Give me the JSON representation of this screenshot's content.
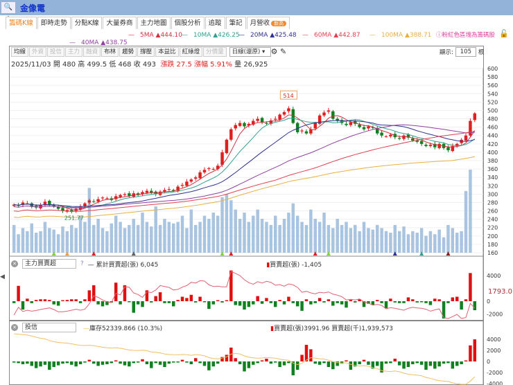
{
  "window": {
    "title": "金像電",
    "zoom_icon": "zoom-in-icon"
  },
  "tabs": [
    {
      "label": "籌碼K線",
      "active": true
    },
    {
      "label": "即時走勢"
    },
    {
      "label": "分點K線"
    },
    {
      "label": "大量券商"
    },
    {
      "label": "主力地圖"
    },
    {
      "label": "個股分析"
    },
    {
      "label": "追蹤"
    },
    {
      "label": "筆記"
    },
    {
      "label": "月營收",
      "badge": "新高"
    }
  ],
  "ma_legend": [
    {
      "label": "5MA",
      "value": "▲444.10",
      "color": "#d03040"
    },
    {
      "label": "10MA",
      "value": "▲426.25",
      "color": "#30a090"
    },
    {
      "label": "20MA",
      "value": "▲425.48",
      "color": "#303090"
    },
    {
      "label": "60MA",
      "value": "▲442.87",
      "color": "#e04050"
    },
    {
      "label": "100MA",
      "value": "▲388.71",
      "color": "#e8b040"
    },
    {
      "label": "40MA",
      "value": "▲438.75",
      "color": "#9040a0"
    }
  ],
  "notice": "ⓘ粉紅色區塊為籌碼股",
  "toolbar": {
    "buttons": [
      {
        "label": "均線"
      },
      {
        "label": "外資",
        "dim": true
      },
      {
        "label": "投信",
        "dim": true
      },
      {
        "label": "主力",
        "dim": true
      },
      {
        "label": "融資",
        "dim": true
      },
      {
        "label": "布林"
      },
      {
        "label": "趨勢"
      },
      {
        "label": "撐壓"
      },
      {
        "label": "本益比"
      },
      {
        "label": "紅綠燈"
      },
      {
        "label": "分價量",
        "dim": true
      }
    ],
    "period": "日線(還原)",
    "show_label": "顯示:",
    "show_count": "105",
    "show_unit": "根"
  },
  "info": {
    "date": "2025/11/03",
    "open": "開 480",
    "high": "高 499.5",
    "low": "低 468",
    "close": "收 493",
    "change": "漲跌 27.5",
    "pct": "漲幅 5.91%",
    "volume": "量 26,925"
  },
  "chart_data": [
    {
      "type": "candlestick",
      "title": "金像電 日線",
      "ylim": [
        160,
        600
      ],
      "yticks": [
        160,
        180,
        200,
        220,
        240,
        260,
        280,
        300,
        320,
        340,
        360,
        380,
        400,
        420,
        440,
        460,
        480,
        500,
        520,
        540,
        560,
        580,
        600
      ],
      "annotations": [
        {
          "label": "514",
          "index": 62
        },
        {
          "label": "251.77",
          "index": 12
        }
      ],
      "close": [
        275,
        272,
        280,
        278,
        270,
        268,
        274,
        282,
        276,
        270,
        265,
        260,
        262,
        258,
        265,
        270,
        278,
        285,
        282,
        288,
        292,
        290,
        286,
        295,
        298,
        300,
        296,
        302,
        298,
        305,
        308,
        304,
        300,
        306,
        310,
        312,
        308,
        318,
        322,
        330,
        335,
        340,
        352,
        358,
        362,
        360,
        368,
        400,
        430,
        455,
        465,
        470,
        462,
        468,
        475,
        480,
        472,
        468,
        476,
        480,
        490,
        496,
        505,
        470,
        448,
        452,
        445,
        455,
        470,
        488,
        495,
        500,
        480,
        475,
        470,
        465,
        472,
        468,
        460,
        455,
        462,
        458,
        445,
        440,
        438,
        442,
        436,
        432,
        440,
        435,
        428,
        425,
        420,
        415,
        418,
        412,
        420,
        410,
        405,
        415,
        420,
        430,
        440,
        475,
        493
      ],
      "volume": [
        9000,
        6000,
        8000,
        7000,
        9500,
        6500,
        7000,
        10000,
        8000,
        7500,
        6000,
        8500,
        7000,
        9000,
        8000,
        12000,
        10000,
        21000,
        9000,
        11000,
        8000,
        7000,
        9500,
        12000,
        10000,
        8000,
        9000,
        11000,
        9000,
        13000,
        10000,
        8500,
        15000,
        9000,
        11000,
        10000,
        9500,
        10000,
        12000,
        8000,
        14000,
        9000,
        10000,
        12000,
        11000,
        13000,
        12000,
        18000,
        19000,
        17000,
        14000,
        11000,
        13000,
        10000,
        12000,
        14000,
        11000,
        10000,
        9000,
        12000,
        9000,
        11000,
        13000,
        16000,
        12000,
        10000,
        9000,
        14000,
        11000,
        10000,
        13000,
        9000,
        8000,
        11000,
        9000,
        10000,
        8000,
        9000,
        7000,
        10000,
        8000,
        7500,
        9000,
        8000,
        7000,
        6500,
        9000,
        7000,
        8500,
        6000,
        7000,
        6500,
        8000,
        5500,
        7000,
        6000,
        7500,
        5000,
        9000,
        8000,
        6500,
        7000,
        20000,
        26925
      ],
      "volume_label": "量"
    },
    {
      "type": "bar",
      "title": "主力買賣超",
      "legend": [
        {
          "label": "累計買賣超(張) 6,045"
        },
        {
          "label": "買賣超(張) -1,405"
        }
      ],
      "ylim": [
        -2000,
        6000
      ],
      "yticks": [
        4000,
        0,
        -2000
      ],
      "last_value_label": "1793.0",
      "values": [
        -300,
        2400,
        -1300,
        400,
        -300,
        200,
        300,
        300,
        200,
        -500,
        -700,
        0,
        200,
        300,
        300,
        -300,
        300,
        1700,
        2500,
        -500,
        -800,
        -600,
        -200,
        2900,
        -500,
        2500,
        -100,
        -1800,
        -500,
        -900,
        1700,
        -200,
        800,
        1400,
        -300,
        -300,
        -800,
        200,
        700,
        500,
        1000,
        -200,
        700,
        -100,
        -1200,
        -500,
        100,
        -200,
        0,
        4800,
        -600,
        -700,
        -1300,
        -900,
        -500,
        800,
        -400,
        500,
        -300,
        -900,
        200,
        -500,
        700,
        -300,
        -800,
        -1500,
        300,
        -500,
        -300,
        500,
        -200,
        300,
        -700,
        -300,
        -500,
        -1000,
        200,
        -200,
        300,
        -900,
        -400,
        -600,
        200,
        -300,
        -1100,
        400,
        -200,
        -300,
        -300,
        600,
        300,
        -200,
        -100,
        -300,
        -600,
        400,
        300,
        -2700,
        -300,
        600,
        700,
        -1300,
        300,
        4400,
        -1405
      ]
    },
    {
      "type": "bar",
      "title": "投信",
      "legend": [
        {
          "label": "庫存52339.866 (10.3%)"
        },
        {
          "label": "買賣超(張)3991.96 買賣超(千)1,939,573"
        }
      ],
      "ylim": [
        -4000,
        6000
      ],
      "yticks": [
        4000,
        2000,
        0,
        -2000,
        -4000
      ],
      "values": [
        -200,
        -300,
        -500,
        -400,
        -800,
        -1200,
        -900,
        -600,
        -1500,
        -1000,
        -700,
        -400,
        -300,
        -600,
        -900,
        -500,
        -200,
        300,
        -400,
        -800,
        -600,
        -500,
        -300,
        200,
        -400,
        -700,
        -900,
        -300,
        -200,
        400,
        -500,
        -1200,
        -300,
        -600,
        -1000,
        -400,
        -200,
        -100,
        300,
        -200,
        -500,
        600,
        -300,
        -800,
        -1600,
        -900,
        -400,
        800,
        1200,
        2500,
        600,
        -500,
        -1800,
        -1200,
        -600,
        -300,
        200,
        500,
        -400,
        -200,
        -1000,
        -700,
        -300,
        -2500,
        -1500,
        1200,
        3000,
        2200,
        -400,
        -600,
        -300,
        -1000,
        -1400,
        -800,
        -400,
        200,
        -1500,
        -900,
        -500,
        300,
        -600,
        -1300,
        -800,
        -2000,
        -400,
        -300,
        500,
        -700,
        -1300,
        -1000,
        -500,
        -300,
        -600,
        -1500,
        -800,
        -1300,
        -900,
        -400,
        -300,
        -1300,
        -800,
        -500,
        0,
        2900,
        3992
      ]
    }
  ]
}
